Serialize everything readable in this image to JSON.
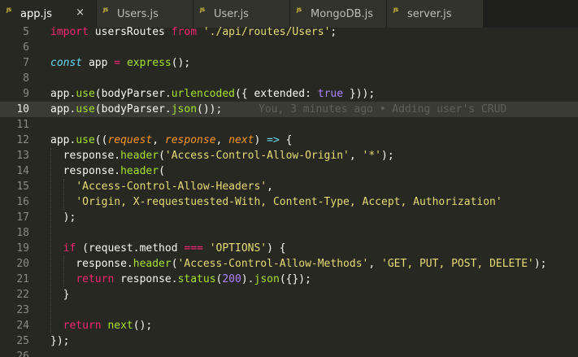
{
  "tabs": [
    {
      "label": "app.js",
      "icon": "js-file-icon",
      "active": true,
      "close": "×"
    },
    {
      "label": "Users.js",
      "icon": "js-file-icon"
    },
    {
      "label": "User.js",
      "icon": "js-file-icon"
    },
    {
      "label": "MongoDB.js",
      "icon": "js-file-icon"
    },
    {
      "label": "server.js",
      "icon": "js-file-icon"
    }
  ],
  "icon_text": "JS",
  "colors": {
    "background": "#272822",
    "keyword": "#f92672",
    "function": "#a6e22e",
    "string": "#e6db74",
    "number": "#ae81ff",
    "parameter": "#fd971f",
    "storage": "#66d9ef"
  },
  "current_line": 10,
  "blame_text": "You, 3 minutes ago • Adding user's CRUD",
  "lines": [
    {
      "n": 5,
      "tokens": [
        [
          "kw",
          "import"
        ],
        [
          "pl",
          " usersRoutes "
        ],
        [
          "kw",
          "from"
        ],
        [
          "pl",
          " "
        ],
        [
          "str",
          "'./api/routes/Users'"
        ],
        [
          "pl",
          ";"
        ]
      ]
    },
    {
      "n": 6,
      "tokens": []
    },
    {
      "n": 7,
      "tokens": [
        [
          "kwi",
          "const"
        ],
        [
          "pl",
          " app "
        ],
        [
          "op",
          "="
        ],
        [
          "pl",
          " "
        ],
        [
          "fn",
          "express"
        ],
        [
          "pl",
          "();"
        ]
      ]
    },
    {
      "n": 8,
      "tokens": []
    },
    {
      "n": 9,
      "tokens": [
        [
          "pl",
          "app."
        ],
        [
          "fn",
          "use"
        ],
        [
          "pl",
          "(bodyParser."
        ],
        [
          "fn",
          "urlencoded"
        ],
        [
          "pl",
          "({ extended: "
        ],
        [
          "num",
          "true"
        ],
        [
          "pl",
          " }));"
        ]
      ]
    },
    {
      "n": 10,
      "tokens": [
        [
          "pl",
          "app."
        ],
        [
          "fn",
          "use"
        ],
        [
          "pl",
          "(bodyParser."
        ],
        [
          "fn",
          "json"
        ],
        [
          "pl",
          "());"
        ]
      ]
    },
    {
      "n": 11,
      "tokens": []
    },
    {
      "n": 12,
      "tokens": [
        [
          "pl",
          "app."
        ],
        [
          "fn",
          "use"
        ],
        [
          "pl",
          "(("
        ],
        [
          "prm",
          "request"
        ],
        [
          "pl",
          ", "
        ],
        [
          "prm",
          "response"
        ],
        [
          "pl",
          ", "
        ],
        [
          "prm",
          "next"
        ],
        [
          "pl",
          ") "
        ],
        [
          "arr",
          "=>"
        ],
        [
          "pl",
          " {"
        ]
      ]
    },
    {
      "n": 13,
      "tokens": [
        [
          "pl",
          "  response."
        ],
        [
          "fn",
          "header"
        ],
        [
          "pl",
          "("
        ],
        [
          "str",
          "'Access-Control-Allow-Origin'"
        ],
        [
          "pl",
          ", "
        ],
        [
          "str",
          "'*'"
        ],
        [
          "pl",
          ");"
        ]
      ]
    },
    {
      "n": 14,
      "tokens": [
        [
          "pl",
          "  response."
        ],
        [
          "fn",
          "header"
        ],
        [
          "pl",
          "("
        ]
      ]
    },
    {
      "n": 15,
      "tokens": [
        [
          "pl",
          "    "
        ],
        [
          "str",
          "'Access-Control-Allow-Headers'"
        ],
        [
          "pl",
          ","
        ]
      ]
    },
    {
      "n": 16,
      "tokens": [
        [
          "pl",
          "    "
        ],
        [
          "str",
          "'Origin, X-requestuested-With, Content-Type, Accept, Authorization'"
        ]
      ]
    },
    {
      "n": 17,
      "tokens": [
        [
          "pl",
          "  );"
        ]
      ]
    },
    {
      "n": 18,
      "tokens": []
    },
    {
      "n": 19,
      "tokens": [
        [
          "pl",
          "  "
        ],
        [
          "kw",
          "if"
        ],
        [
          "pl",
          " (request.method "
        ],
        [
          "op",
          "==="
        ],
        [
          "pl",
          " "
        ],
        [
          "str",
          "'OPTIONS'"
        ],
        [
          "pl",
          ") {"
        ]
      ]
    },
    {
      "n": 20,
      "tokens": [
        [
          "pl",
          "    response."
        ],
        [
          "fn",
          "header"
        ],
        [
          "pl",
          "("
        ],
        [
          "str",
          "'Access-Control-Allow-Methods'"
        ],
        [
          "pl",
          ", "
        ],
        [
          "str",
          "'GET, PUT, POST, DELETE'"
        ],
        [
          "pl",
          ");"
        ]
      ]
    },
    {
      "n": 21,
      "tokens": [
        [
          "pl",
          "    "
        ],
        [
          "kw",
          "return"
        ],
        [
          "pl",
          " response."
        ],
        [
          "fn",
          "status"
        ],
        [
          "pl",
          "("
        ],
        [
          "num",
          "200"
        ],
        [
          "pl",
          ")."
        ],
        [
          "fn",
          "json"
        ],
        [
          "pl",
          "({});"
        ]
      ]
    },
    {
      "n": 22,
      "tokens": [
        [
          "pl",
          "  }"
        ]
      ]
    },
    {
      "n": 23,
      "tokens": []
    },
    {
      "n": 24,
      "tokens": [
        [
          "pl",
          "  "
        ],
        [
          "kw",
          "return"
        ],
        [
          "pl",
          " "
        ],
        [
          "fn",
          "next"
        ],
        [
          "pl",
          "();"
        ]
      ]
    },
    {
      "n": 25,
      "tokens": [
        [
          "pl",
          "});"
        ]
      ]
    },
    {
      "n": 26,
      "tokens": []
    }
  ]
}
